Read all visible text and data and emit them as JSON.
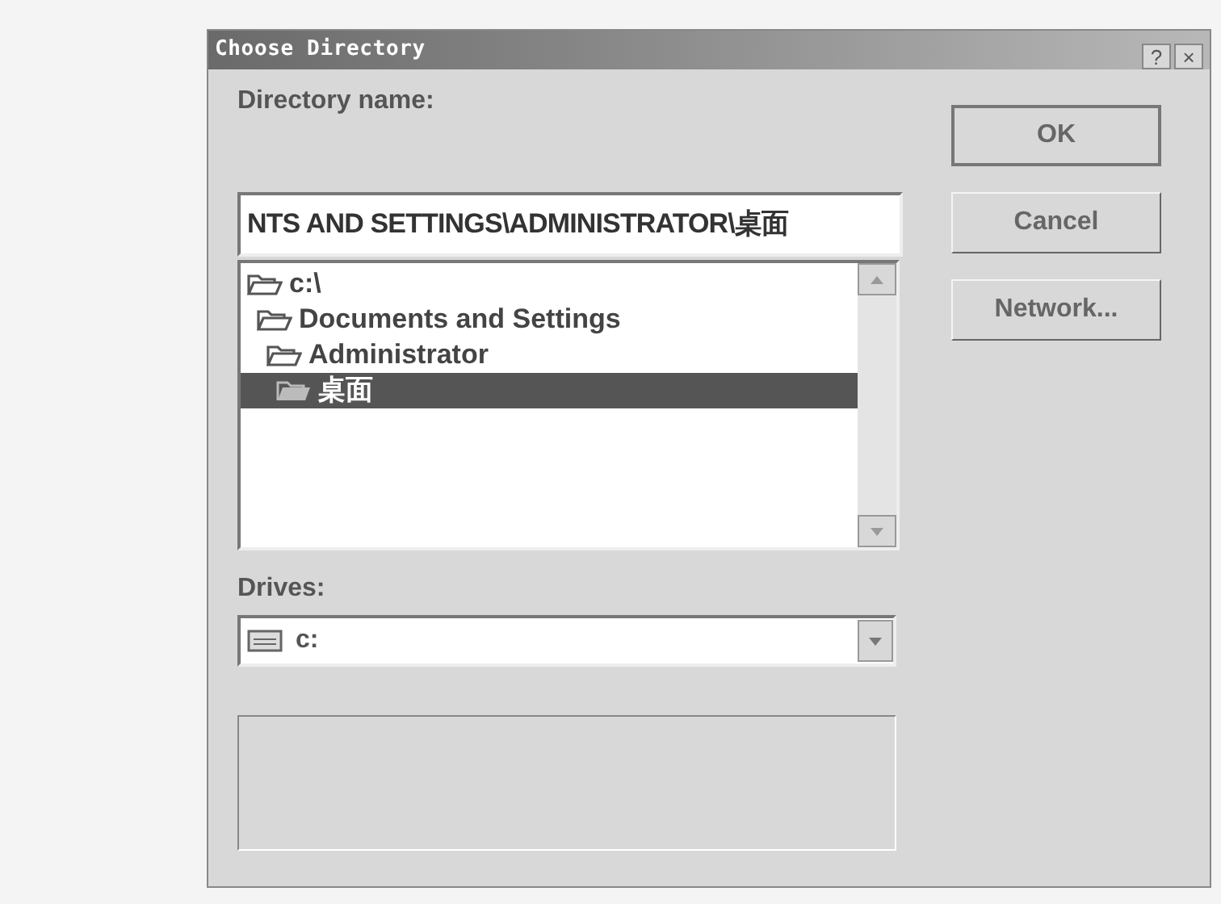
{
  "window": {
    "title": "Choose Directory",
    "title_buttons": [
      "?",
      "×"
    ]
  },
  "directory_name": {
    "label": "Directory name:",
    "value": "NTS AND SETTINGS\\ADMINISTRATOR\\桌面"
  },
  "folders": [
    {
      "name": "c:\\",
      "selected": false,
      "children": [
        {
          "name": "Documents and Settings",
          "selected": false,
          "children": [
            {
              "name": "Administrator",
              "selected": false,
              "children": [
                {
                  "name": "桌面",
                  "selected": true
                }
              ]
            }
          ]
        }
      ]
    }
  ],
  "drives": {
    "label": "Drives:",
    "value": "c:"
  },
  "buttons": [
    {
      "label": "OK",
      "default": true
    },
    {
      "label": "Cancel",
      "default": false
    },
    {
      "label": "Network...",
      "default": false
    }
  ]
}
